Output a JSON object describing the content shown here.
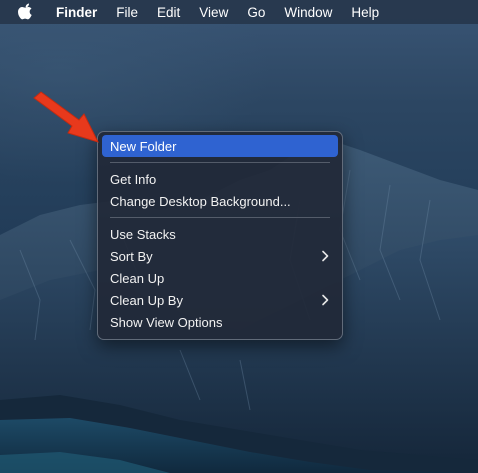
{
  "menubar": {
    "app_name": "Finder",
    "items": [
      "File",
      "Edit",
      "View",
      "Go",
      "Window",
      "Help"
    ]
  },
  "context_menu": {
    "new_folder": "New Folder",
    "get_info": "Get Info",
    "change_background": "Change Desktop Background...",
    "use_stacks": "Use Stacks",
    "sort_by": "Sort By",
    "clean_up": "Clean Up",
    "clean_up_by": "Clean Up By",
    "show_view_options": "Show View Options"
  },
  "colors": {
    "highlight": "#2f63d1",
    "arrow": "#e8391c"
  },
  "icons": {
    "apple": "apple-icon",
    "submenu": "chevron-right-icon",
    "pointer": "red-arrow-icon"
  }
}
